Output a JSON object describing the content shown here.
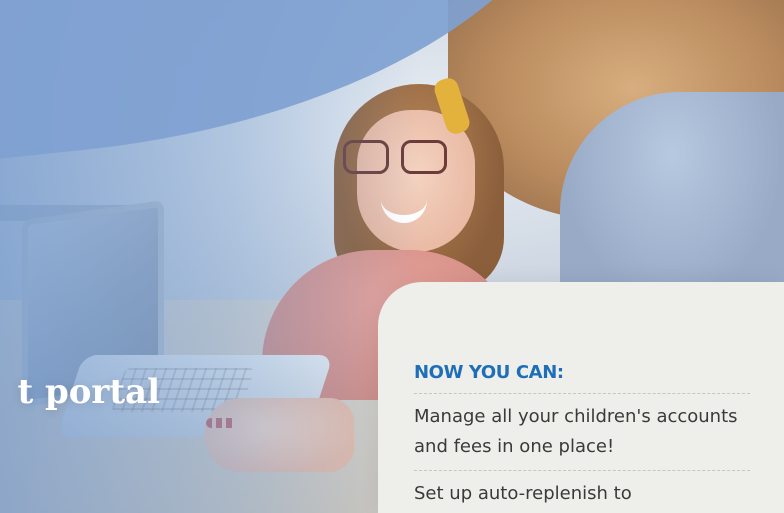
{
  "hero": {
    "title_partial": "t portal"
  },
  "card": {
    "heading": "NOW YOU CAN:",
    "items": [
      "Manage all your children's accounts and fees in one place!",
      "Set up auto-replenish to"
    ]
  },
  "colors": {
    "accent_blue": "#1f6fb8",
    "card_bg": "#eeeeea",
    "hero_wash": "#7fa1d1"
  }
}
